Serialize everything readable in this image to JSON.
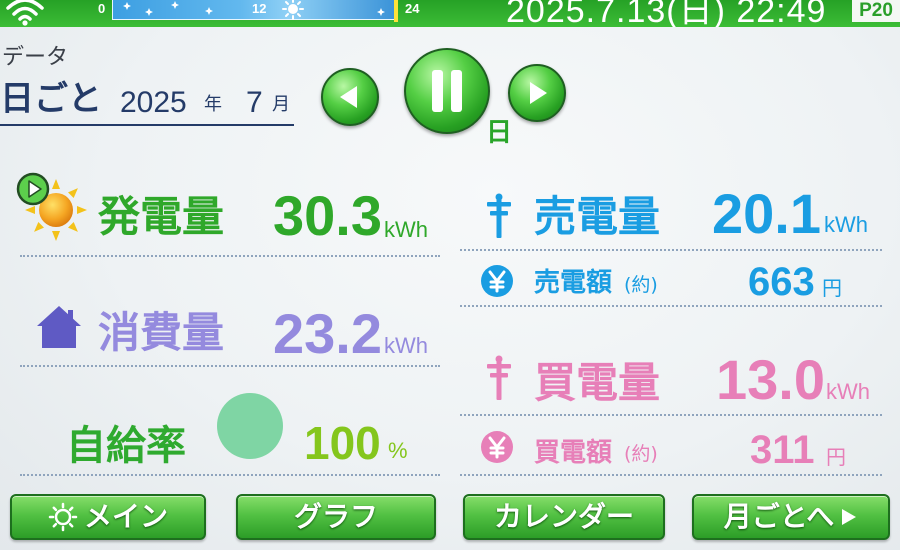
{
  "status_bar": {
    "wifi_icon": "wifi-icon",
    "timeline": {
      "start_label": "0",
      "mid_label": "12",
      "end_label": "24",
      "day_icon": "sun-icon",
      "night_icon": "moon-icon"
    },
    "datetime": "2025.7.13(日) 22:49",
    "page_indicator": "P20",
    "bar_color": "#31b232"
  },
  "header": {
    "section_title": "データ",
    "period_mode": "日ごと",
    "year": "2025",
    "year_suffix": "年",
    "month": "7",
    "month_suffix": "月"
  },
  "navigation": {
    "prev_icon": "triangle-left-icon",
    "pause_icon": "pause-icon",
    "next_icon": "triangle-right-icon",
    "step_label": "日"
  },
  "metrics": {
    "generation": {
      "label": "発電量",
      "value": "30.3",
      "unit": "kWh",
      "icon": "sun-icon",
      "color": "#2fa82a"
    },
    "consumption": {
      "label": "消費量",
      "value": "23.2",
      "unit": "kWh",
      "icon": "house-icon",
      "color": "#948ade",
      "icon_color": "#5f5ac4"
    },
    "self_sufficiency": {
      "label": "自給率",
      "value": "100",
      "unit": "%",
      "color": "#2faa2f",
      "value_color": "#84c61c",
      "gauge_color": "#7fd5a4"
    },
    "sold_energy": {
      "label": "売電量",
      "value": "20.1",
      "unit": "kWh",
      "icon": "power-pylon-icon",
      "color": "#1a9de2"
    },
    "sold_amount": {
      "label": "売電額",
      "qualifier": "(約)",
      "value": "663",
      "unit": "円",
      "icon": "yen-icon",
      "color": "#1a9de2"
    },
    "bought_energy": {
      "label": "買電量",
      "value": "13.0",
      "unit": "kWh",
      "icon": "power-pylon-icon",
      "color": "#e77fb8"
    },
    "bought_amount": {
      "label": "買電額",
      "qualifier": "(約)",
      "value": "311",
      "unit": "円",
      "icon": "yen-icon",
      "color": "#e77fb8"
    }
  },
  "bottom_nav": [
    {
      "label": "メイン",
      "icon": "sun-outline-icon"
    },
    {
      "label": "グラフ"
    },
    {
      "label": "カレンダー"
    },
    {
      "label": "月ごとへ",
      "icon": "triangle-right-icon"
    }
  ]
}
